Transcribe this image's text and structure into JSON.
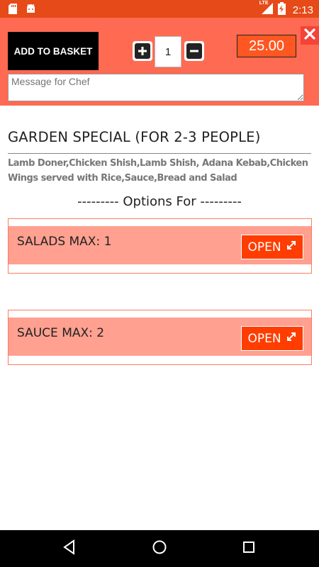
{
  "status_bar": {
    "network": "LTE",
    "time": "2:13",
    "icons": [
      "sd-card-icon",
      "android-icon",
      "signal-icon",
      "battery-charging-icon"
    ]
  },
  "header": {
    "add_to_basket": "ADD TO BASKET",
    "quantity": "1",
    "price": "25.00",
    "chef_message_placeholder": "Message for Chef",
    "chef_message_value": ""
  },
  "item": {
    "title": "GARDEN SPECIAL (FOR 2-3 PEOPLE)",
    "description": "Lamb Doner,Chicken Shish,Lamb Shish, Adana Kebab,Chicken Wings served with Rice,Sauce,Bread and Salad"
  },
  "options": {
    "heading": "--------- Options For ---------",
    "groups": [
      {
        "label": "SALADS MAX: 1",
        "button": "OPEN"
      },
      {
        "label": "SAUCE MAX: 2",
        "button": "OPEN"
      }
    ]
  },
  "colors": {
    "status_bar": "#e64a19",
    "header_bg": "#ff6a52",
    "price_bg": "#ff5722",
    "option_band": "#ffa090",
    "open_button": "#ff3d00",
    "close_button": "#f4433a"
  }
}
